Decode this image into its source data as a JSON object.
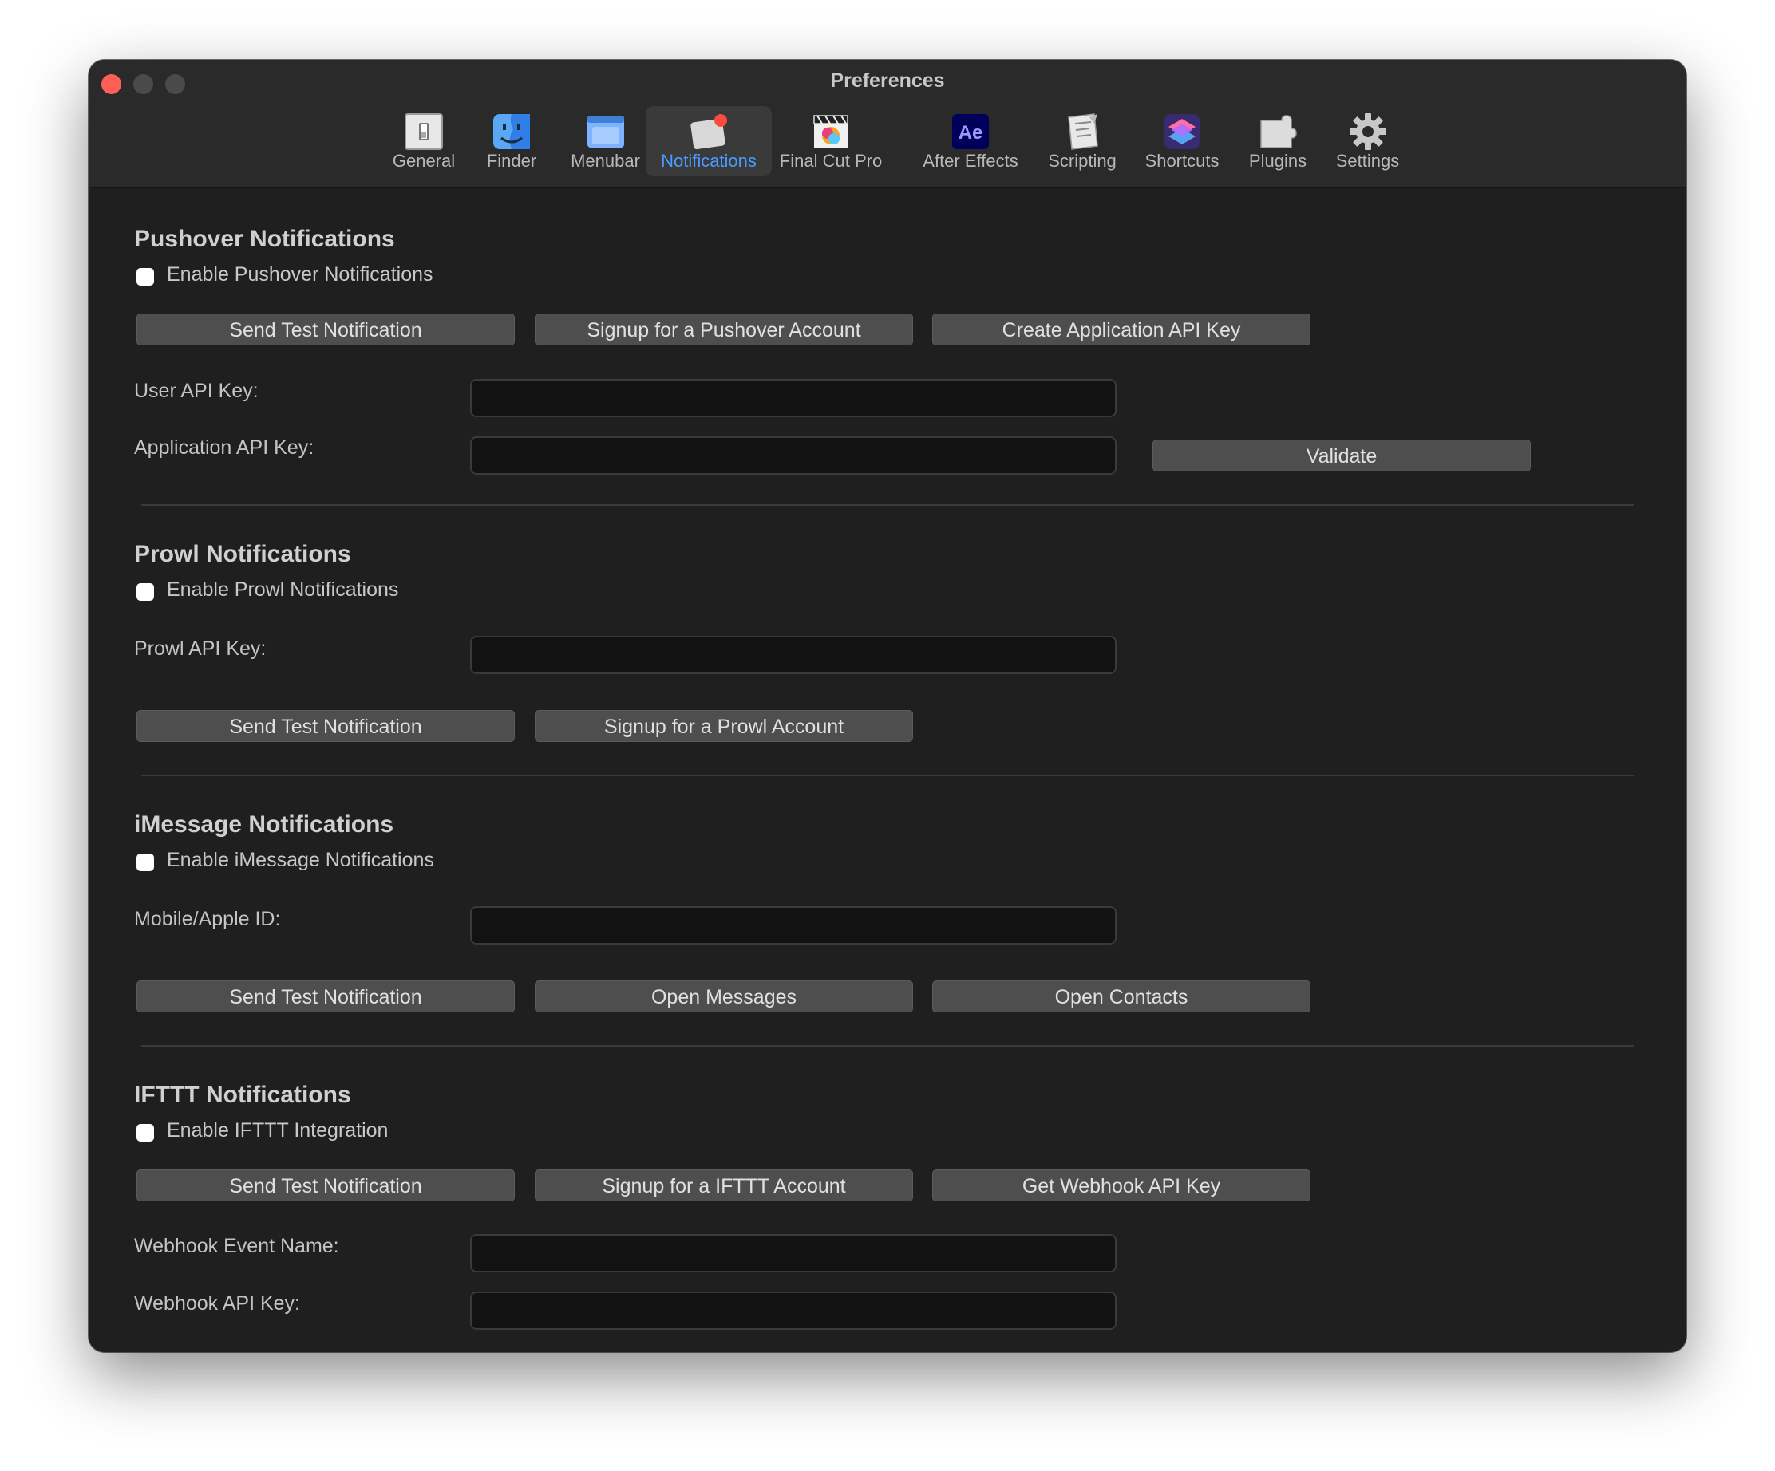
{
  "window": {
    "title": "Preferences"
  },
  "toolbar": {
    "items": [
      {
        "label": "General",
        "icon": "general-switch-icon"
      },
      {
        "label": "Finder",
        "icon": "finder-icon"
      },
      {
        "label": "Menubar",
        "icon": "menubar-icon"
      },
      {
        "label": "Notifications",
        "icon": "notifications-icon",
        "selected": true
      },
      {
        "label": "Final Cut Pro",
        "icon": "final-cut-pro-icon"
      },
      {
        "label": "After Effects",
        "icon": "after-effects-icon",
        "icon_text": "Ae"
      },
      {
        "label": "Scripting",
        "icon": "scripting-icon"
      },
      {
        "label": "Shortcuts",
        "icon": "shortcuts-icon"
      },
      {
        "label": "Plugins",
        "icon": "plugins-icon"
      },
      {
        "label": "Settings",
        "icon": "gear-icon"
      }
    ]
  },
  "pushover": {
    "title": "Pushover Notifications",
    "enable_label": "Enable Pushover Notifications",
    "enabled": false,
    "buttons": [
      "Send Test Notification",
      "Signup for a Pushover Account",
      "Create Application API Key"
    ],
    "user_key_label": "User API Key:",
    "user_key_value": "",
    "app_key_label": "Application API Key:",
    "app_key_value": "",
    "validate_label": "Validate"
  },
  "prowl": {
    "title": "Prowl Notifications",
    "enable_label": "Enable Prowl Notifications",
    "enabled": false,
    "api_key_label": "Prowl API Key:",
    "api_key_value": "",
    "buttons": [
      "Send Test Notification",
      "Signup for a Prowl Account"
    ]
  },
  "imessage": {
    "title": "iMessage Notifications",
    "enable_label": "Enable iMessage Notifications",
    "enabled": false,
    "id_label": "Mobile/Apple ID:",
    "id_value": "",
    "buttons": [
      "Send Test Notification",
      "Open Messages",
      "Open Contacts"
    ]
  },
  "ifttt": {
    "title": "IFTTT Notifications",
    "enable_label": "Enable IFTTT Integration",
    "enabled": false,
    "buttons": [
      "Send Test Notification",
      "Signup for a IFTTT Account",
      "Get Webhook API Key"
    ],
    "event_label": "Webhook Event Name:",
    "event_value": "",
    "api_key_label": "Webhook API Key:",
    "api_key_value": ""
  },
  "colors": {
    "window_bg": "#1f1f1f",
    "titlebar_bg": "#2a2a2a",
    "accent": "#4a9bff",
    "close": "#ff5f57",
    "button_bg": "#4e4e4e",
    "field_bg": "#121212"
  }
}
